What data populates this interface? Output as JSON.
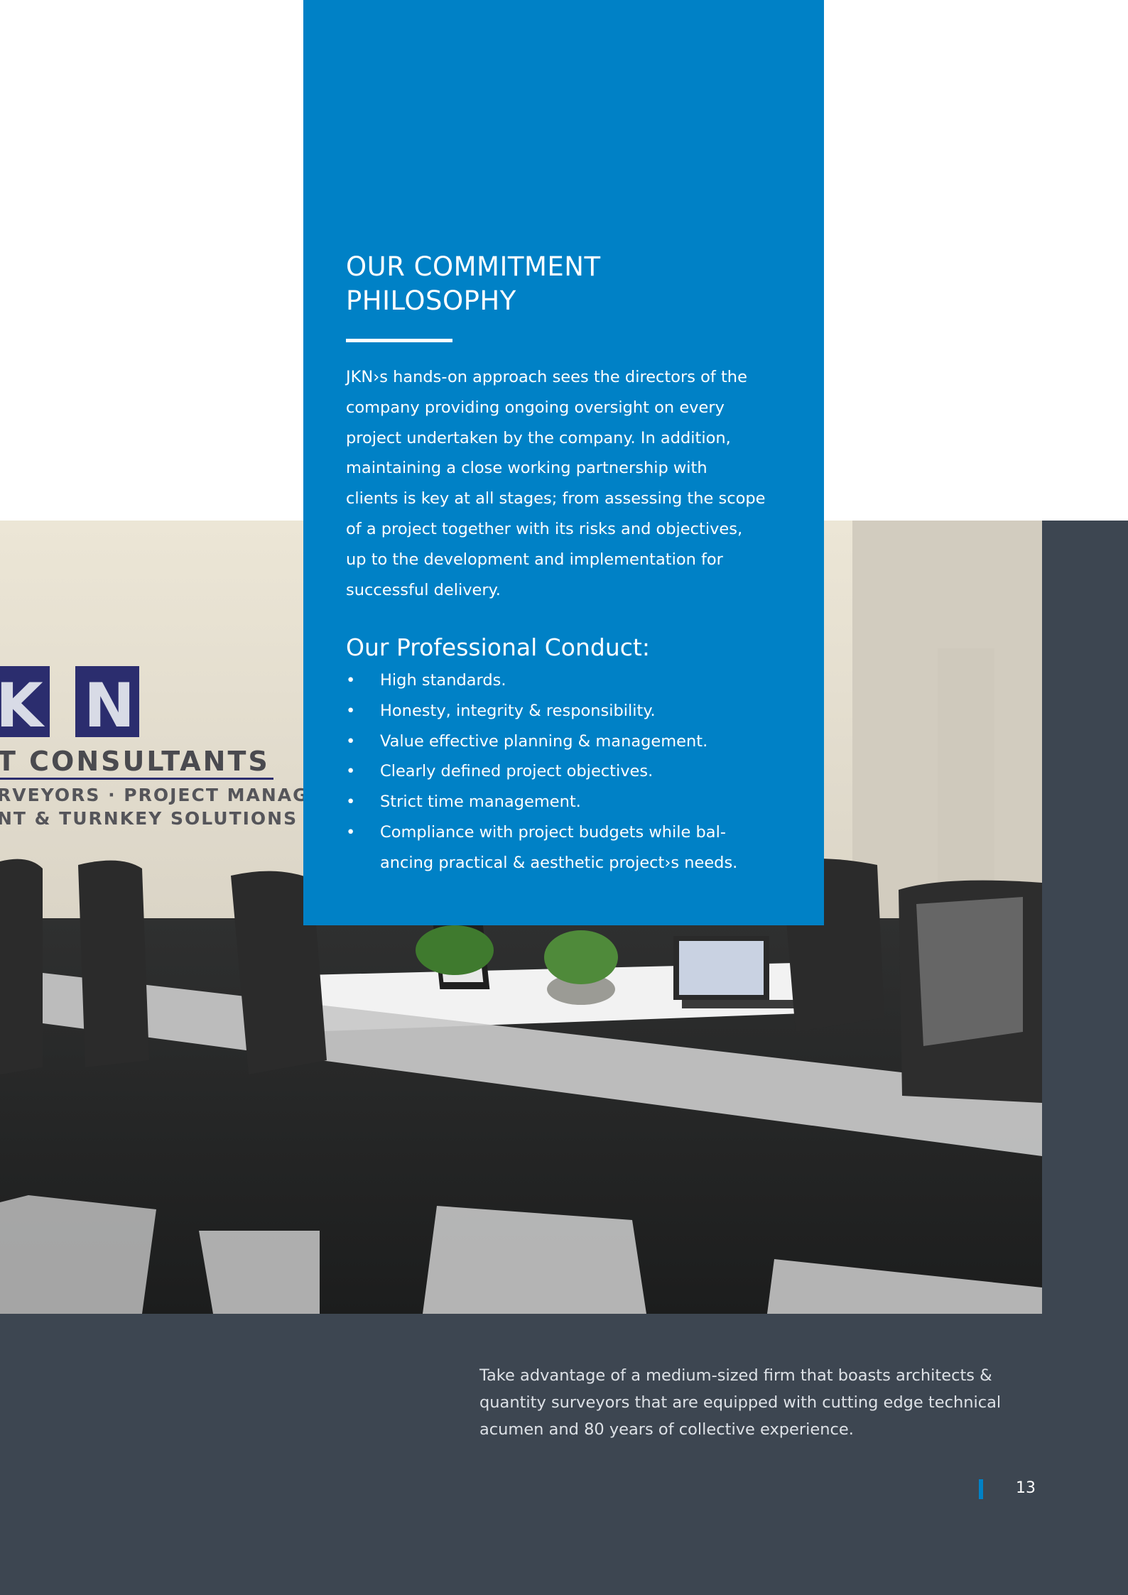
{
  "panel": {
    "title_lines": [
      "OUR COMMITMENT",
      "PHILOSOPHY"
    ],
    "intro_lines": [
      "JKN›s hands-on approach sees the directors of the",
      "company providing ongoing oversight on every",
      "project undertaken by the company. In addition,",
      "maintaining a close working partnership with",
      "clients is key at all stages; from assessing the scope",
      "of a project together with its risks and objectives,",
      "up to the development and implementation for",
      "successful delivery."
    ],
    "conduct_title": "Our Professional Conduct:",
    "bullet": "•",
    "conduct_items": [
      [
        "High standards."
      ],
      [
        "Honesty, integrity & responsibility."
      ],
      [
        "Value effective planning & management."
      ],
      [
        "Clearly defined project objectives."
      ],
      [
        "Strict time management."
      ],
      [
        "Compliance with project budgets while bal-",
        "ancing practical & aesthetic project›s needs."
      ]
    ]
  },
  "photo": {
    "logo_letters": [
      "K",
      "N"
    ],
    "logo_line1": "T CONSULTANTS",
    "logo_line2": "RVEYORS · PROJECT MANAGE",
    "logo_line3": "NT & TURNKEY SOLUTIONS"
  },
  "footer": {
    "text_lines": [
      "Take advantage of a medium-sized firm that boasts architects &",
      "quantity surveyors that are equipped with cutting edge technical",
      "acumen and 80 years of collective experience."
    ],
    "page_number": "13"
  },
  "colors": {
    "brand_blue": "#0081c6",
    "dark_slate": "#3d4651",
    "logo_navy": "#2b2d6e"
  }
}
